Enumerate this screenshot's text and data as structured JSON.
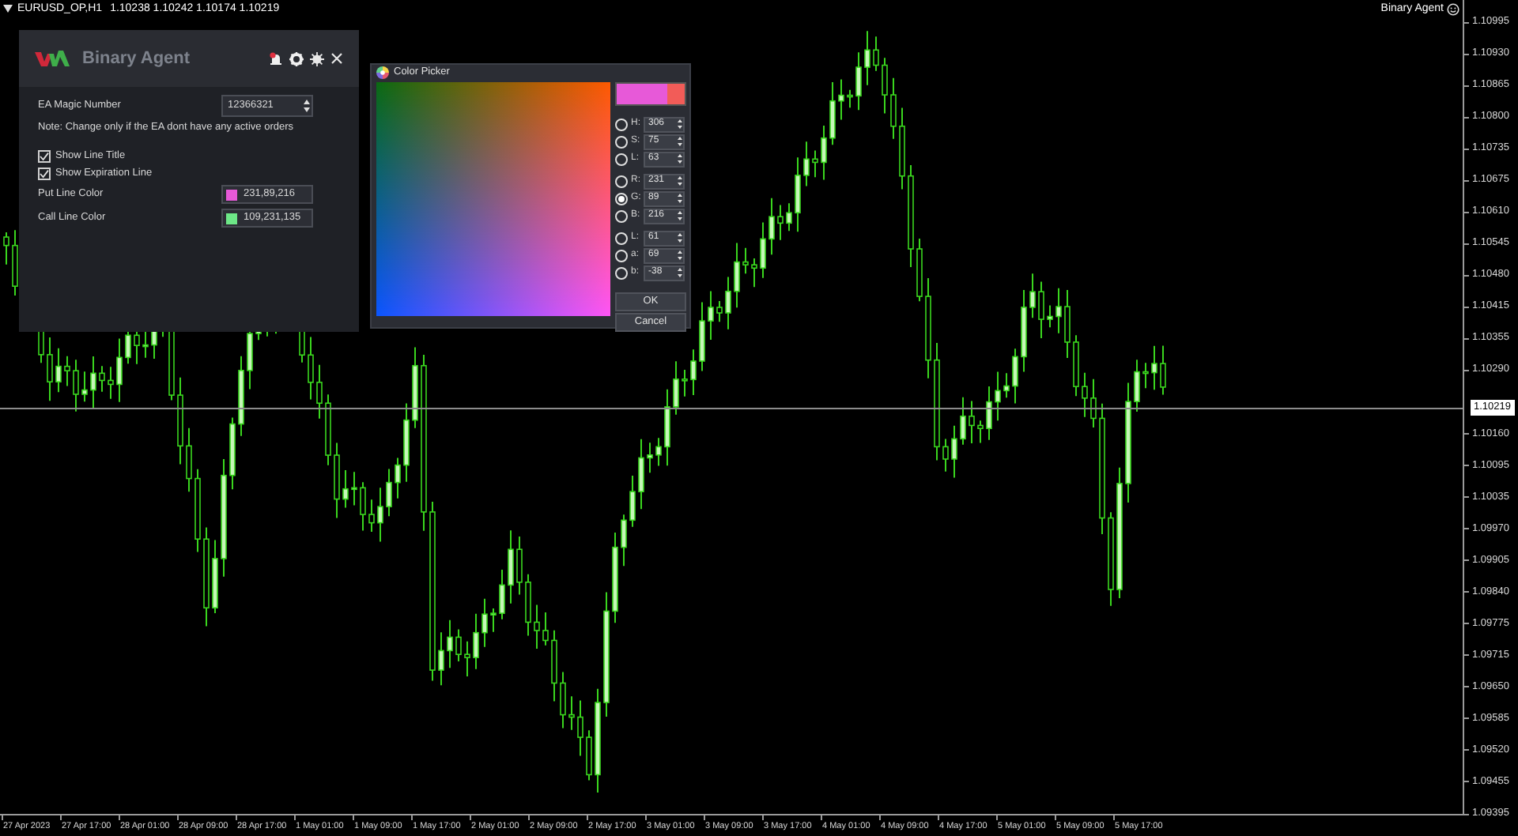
{
  "chart_header": {
    "symbol": "EURUSD_OP,H1",
    "quote": "1.10238 1.10242 1.10174 1.10219"
  },
  "indicator_label": "Binary Agent",
  "price_axis": {
    "labels": [
      "1.10995",
      "1.10930",
      "1.10865",
      "1.10800",
      "1.10735",
      "1.10675",
      "1.10610",
      "1.10545",
      "1.10480",
      "1.10415",
      "1.10355",
      "1.10290",
      "1.10160",
      "1.10095",
      "1.10035",
      "1.09970",
      "1.09905",
      "1.09840",
      "1.09775",
      "1.09715",
      "1.09650",
      "1.09585",
      "1.09520",
      "1.09455",
      "1.09395"
    ],
    "current_price": "1.10219"
  },
  "time_axis": {
    "labels": [
      "27 Apr 2023",
      "27 Apr 17:00",
      "28 Apr 01:00",
      "28 Apr 09:00",
      "28 Apr 17:00",
      "1 May 01:00",
      "1 May 09:00",
      "1 May 17:00",
      "2 May 01:00",
      "2 May 09:00",
      "2 May 17:00",
      "3 May 01:00",
      "3 May 09:00",
      "3 May 17:00",
      "4 May 01:00",
      "4 May 09:00",
      "4 May 17:00",
      "5 May 01:00",
      "5 May 09:00",
      "5 May 17:00"
    ]
  },
  "panel": {
    "title": "Binary Agent",
    "magic_number_label": "EA Magic Number",
    "magic_number": "12366321",
    "note": "Note: Change only if the EA dont have any active orders",
    "checkboxes": [
      {
        "label": "Show Line Title",
        "checked": true
      },
      {
        "label": "Show Expiration Line",
        "checked": true
      }
    ],
    "color_rows": [
      {
        "label": "Put Line Color",
        "value": "231,89,216",
        "color": "#e759d8"
      },
      {
        "label": "Call Line Color",
        "value": "109,231,135",
        "color": "#6de787"
      }
    ]
  },
  "color_picker": {
    "title": "Color Picker",
    "swatches": [
      {
        "kind": "new",
        "color": "#e759d8"
      },
      {
        "kind": "old",
        "color": "#f25c58"
      }
    ],
    "groups": [
      [
        {
          "label": "H:",
          "value": "306",
          "selected": false
        },
        {
          "label": "S:",
          "value": "75",
          "selected": false
        },
        {
          "label": "L:",
          "value": "63",
          "selected": false
        }
      ],
      [
        {
          "label": "R:",
          "value": "231",
          "selected": false
        },
        {
          "label": "G:",
          "value": "89",
          "selected": true
        },
        {
          "label": "B:",
          "value": "216",
          "selected": false
        }
      ],
      [
        {
          "label": "L:",
          "value": "61",
          "selected": false
        },
        {
          "label": "a:",
          "value": "69",
          "selected": false
        },
        {
          "label": "b:",
          "value": "-38",
          "selected": false
        }
      ]
    ],
    "buttons": [
      "OK",
      "Cancel"
    ]
  }
}
